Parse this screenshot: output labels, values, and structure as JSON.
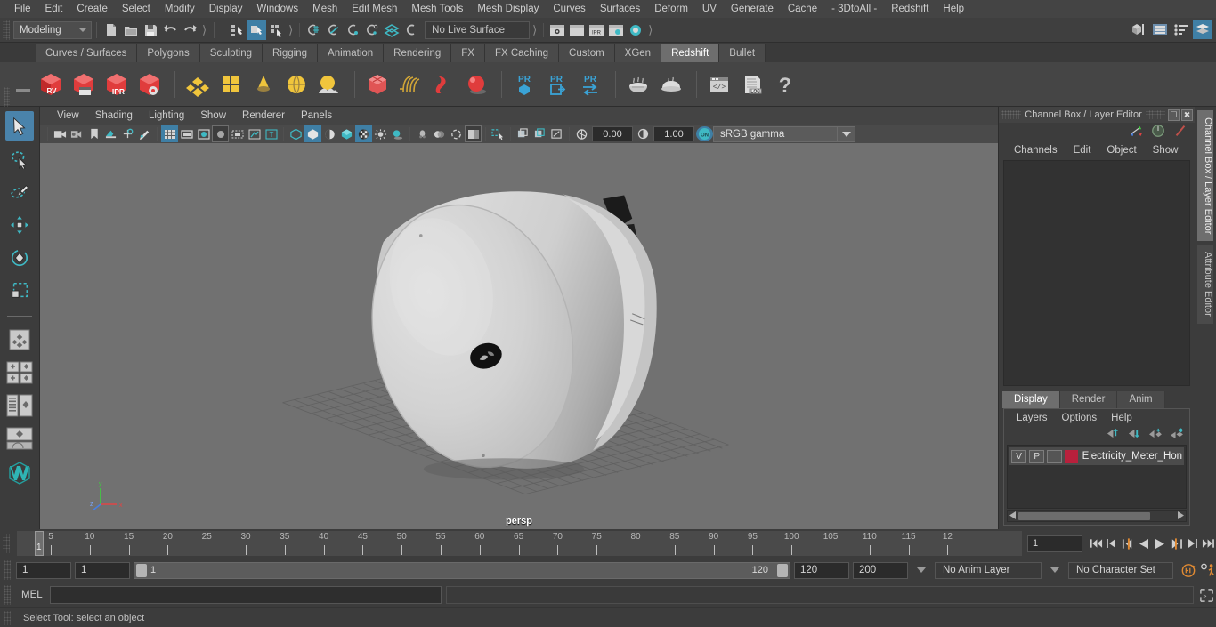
{
  "menubar": {
    "items": [
      "File",
      "Edit",
      "Create",
      "Select",
      "Modify",
      "Display",
      "Windows",
      "Mesh",
      "Edit Mesh",
      "Mesh Tools",
      "Mesh Display",
      "Curves",
      "Surfaces",
      "Deform",
      "UV",
      "Generate",
      "Cache",
      "- 3DtoAll -",
      "Redshift",
      "Help"
    ]
  },
  "statusline": {
    "menuset": "Modeling",
    "live_surface": "No Live Surface"
  },
  "shelf": {
    "tabs": [
      "Curves / Surfaces",
      "Polygons",
      "Sculpting",
      "Rigging",
      "Animation",
      "Rendering",
      "FX",
      "FX Caching",
      "Custom",
      "XGen",
      "Redshift",
      "Bullet"
    ],
    "active_tab": "Redshift",
    "icon_labels": [
      "RV",
      "IPR",
      ".LOG",
      "PR"
    ]
  },
  "viewport": {
    "menus": [
      "View",
      "Shading",
      "Lighting",
      "Show",
      "Renderer",
      "Panels"
    ],
    "exposure": "0.00",
    "gamma": "1.00",
    "color_profile": "sRGB gamma",
    "camera_label": "persp",
    "axis": {
      "x": "x",
      "y": "y",
      "z": "z"
    }
  },
  "channelbox": {
    "dock_title": "Channel Box / Layer Editor",
    "menus": [
      "Channels",
      "Edit",
      "Object",
      "Show"
    ]
  },
  "layereditor": {
    "tabs": [
      "Display",
      "Render",
      "Anim"
    ],
    "active_tab": "Display",
    "menus": [
      "Layers",
      "Options",
      "Help"
    ],
    "layers": [
      {
        "visible": "V",
        "playback": "P",
        "state": "",
        "color": "#b8203c",
        "name": "Electricity_Meter_Hone"
      }
    ]
  },
  "vertical_tabs": [
    {
      "label": "Channel Box / Layer Editor",
      "active": true
    },
    {
      "label": "Attribute Editor",
      "active": false
    }
  ],
  "timeline": {
    "tick_labels": [
      "5",
      "10",
      "15",
      "20",
      "25",
      "30",
      "35",
      "40",
      "45",
      "50",
      "55",
      "60",
      "65",
      "70",
      "75",
      "80",
      "85",
      "90",
      "95",
      "100",
      "105",
      "110",
      "115",
      "12"
    ],
    "current_frame_marker": "1",
    "current_frame_field": "1"
  },
  "range": {
    "start": "1",
    "end": "1",
    "slider_start": "1",
    "slider_end": "120",
    "range_end": "120",
    "playback_end": "200",
    "anim_layer": "No Anim Layer",
    "character_set": "No Character Set"
  },
  "commandline": {
    "language": "MEL",
    "input_value": "",
    "output_value": ""
  },
  "helpline": {
    "text": "Select Tool: select an object"
  },
  "colors": {
    "accent_blue": "#3f7fa5",
    "teal": "#3fb9c4",
    "shelf_red": "#e03c3c",
    "shelf_yellow": "#f0c53c",
    "orange": "#e08a33",
    "layer_red": "#b8203c",
    "viewport_bg": "#717171"
  }
}
